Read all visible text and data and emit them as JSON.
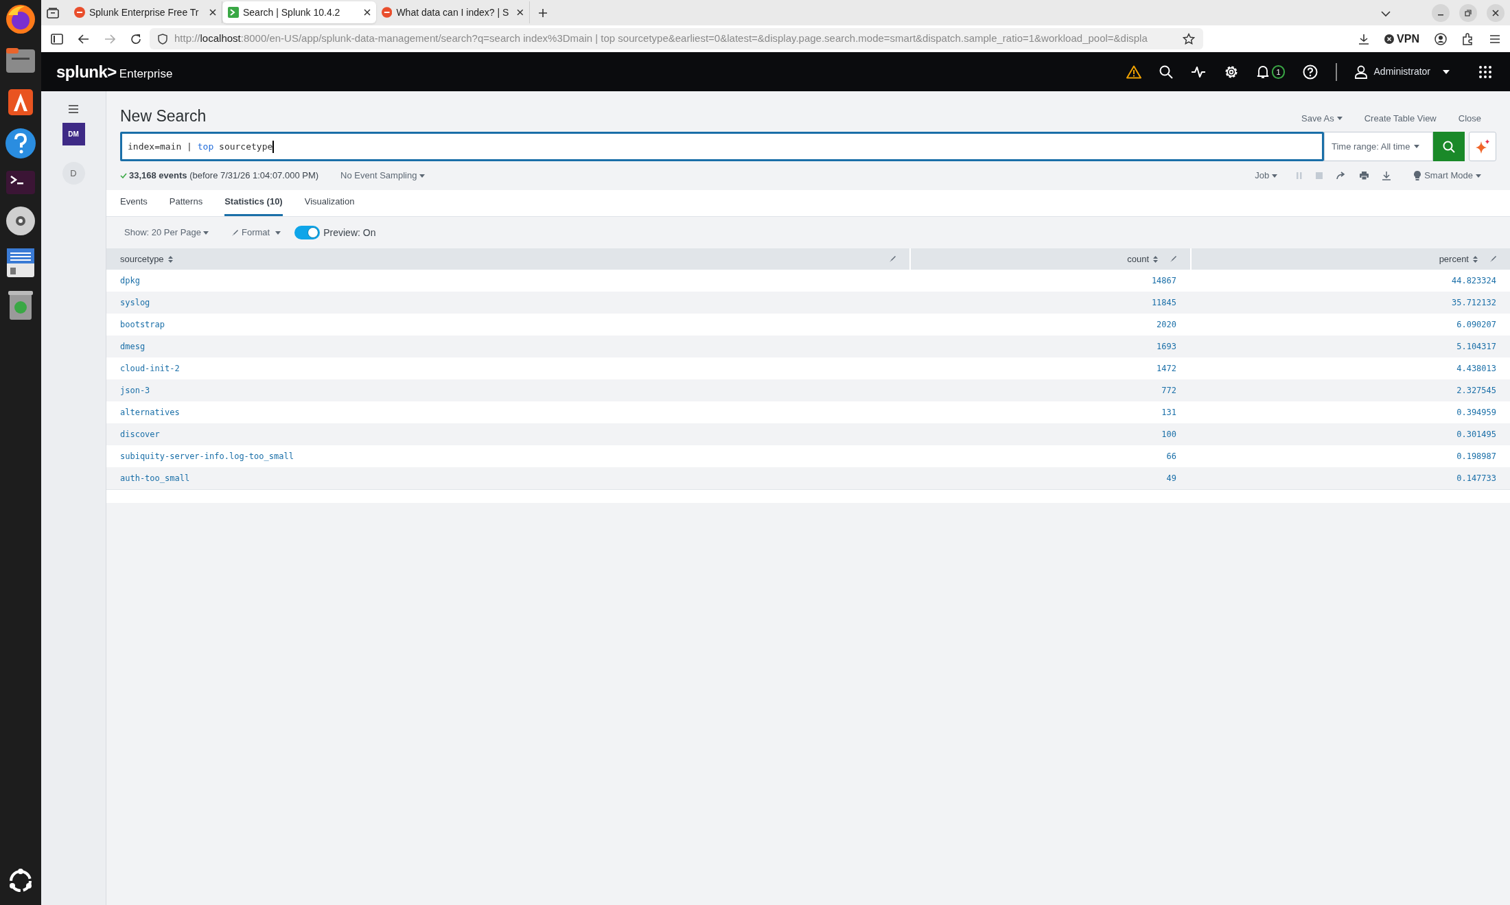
{
  "browser": {
    "tabs": [
      {
        "title": "Splunk Enterprise Free Tr",
        "selected": false
      },
      {
        "title": "Search | Splunk 10.4.2",
        "selected": true
      },
      {
        "title": "What data can I index? | S",
        "selected": false
      }
    ],
    "url_scheme": "http://",
    "url_host": "localhost",
    "url_rest": ":8000/en-US/app/splunk-data-management/search?q=search index%3Dmain | top sourcetype&earliest=0&latest=&display.page.search.mode=smart&dispatch.sample_ratio=1&workload_pool=&displa",
    "vpn": "VPN"
  },
  "header": {
    "logo": "splunk>",
    "product": "Enterprise",
    "notification_count": "1",
    "user": "Administrator"
  },
  "app_sidebar": {
    "app_badge": "DM",
    "avatar": "D"
  },
  "search": {
    "title": "New Search",
    "actions": [
      "Save As",
      "Create Table View",
      "Close"
    ],
    "query": [
      {
        "text": "index=main | ",
        "kind": "plain"
      },
      {
        "text": "top",
        "kind": "keyword"
      },
      {
        "text": " sourcetype",
        "kind": "plain"
      }
    ],
    "time_range": "Time range: All time",
    "status": "**33,168 events** (before 7/31/26 1:04:07.000 PM)",
    "sampling": "No Event Sampling",
    "job": "Job",
    "mode": "Smart Mode"
  },
  "tabs": [
    {
      "label": "Events",
      "selected": false
    },
    {
      "label": "Patterns",
      "selected": false
    },
    {
      "label": "Statistics (10)",
      "selected": true
    },
    {
      "label": "Visualization",
      "selected": false
    }
  ],
  "toolbar": {
    "page_size": "Show: 20 Per Page",
    "format": "Format",
    "preview": {
      "label": "Preview: On",
      "on": true
    }
  },
  "table": {
    "columns": [
      "sourcetype",
      "count",
      "percent"
    ],
    "rows": [
      [
        "dpkg",
        "14867",
        "44.823324"
      ],
      [
        "syslog",
        "11845",
        "35.712132"
      ],
      [
        "bootstrap",
        "2020",
        "6.090207"
      ],
      [
        "dmesg",
        "1693",
        "5.104317"
      ],
      [
        "cloud-init-2",
        "1472",
        "4.438013"
      ],
      [
        "json-3",
        "772",
        "2.327545"
      ],
      [
        "alternatives",
        "131",
        "0.394959"
      ],
      [
        "discover",
        "100",
        "0.301495"
      ],
      [
        "subiquity-server-info.log-too_small",
        "66",
        "0.198987"
      ],
      [
        "auth-too_small",
        "49",
        "0.147733"
      ]
    ]
  }
}
